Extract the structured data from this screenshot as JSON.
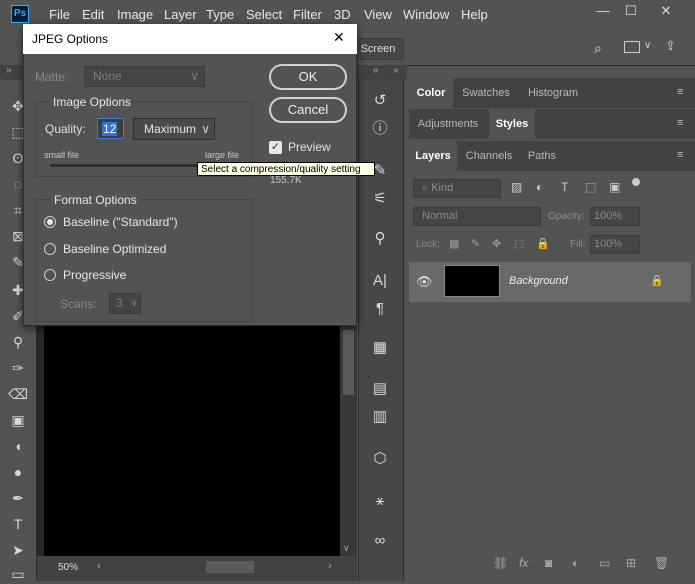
{
  "app": {
    "logo_text": "Ps"
  },
  "menu": [
    "File",
    "Edit",
    "Image",
    "Layer",
    "Type",
    "Select",
    "Filter",
    "3D",
    "View",
    "Window",
    "Help"
  ],
  "options_bar": {
    "screen_button": "Screen"
  },
  "status": {
    "zoom": "50%"
  },
  "right_panels": {
    "row1_tabs": [
      "Color",
      "Swatches",
      "Histogram"
    ],
    "row1_active": "Color",
    "row2_tabs": [
      "Adjustments",
      "Styles"
    ],
    "row2_active": "Styles",
    "row3_tabs": [
      "Layers",
      "Channels",
      "Paths"
    ],
    "row3_active": "Layers",
    "filter_kind": "Kind",
    "blend_mode": "Normal",
    "opacity_label": "Opacity:",
    "opacity_value": "100%",
    "lock_label": "Lock:",
    "fill_label": "Fill:",
    "fill_value": "100%",
    "layer_name": "Background"
  },
  "dialog": {
    "title": "JPEG Options",
    "close": "✕",
    "matte_label": "Matte:",
    "matte_value": "None",
    "image_options_title": "Image Options",
    "quality_label": "Quality:",
    "quality_value": "12",
    "quality_preset": "Maximum",
    "small_file": "small file",
    "large_file": "large file",
    "quality_slider_fraction": 1.0,
    "format_options_title": "Format Options",
    "radio_baseline": "Baseline (\"Standard\")",
    "radio_optimized": "Baseline Optimized",
    "radio_progressive": "Progressive",
    "scans_label": "Scans:",
    "scans_value": "3",
    "ok": "OK",
    "cancel": "Cancel",
    "preview_label": "Preview",
    "file_size": "155.7K",
    "tooltip": "Select a compression/quality setting"
  }
}
